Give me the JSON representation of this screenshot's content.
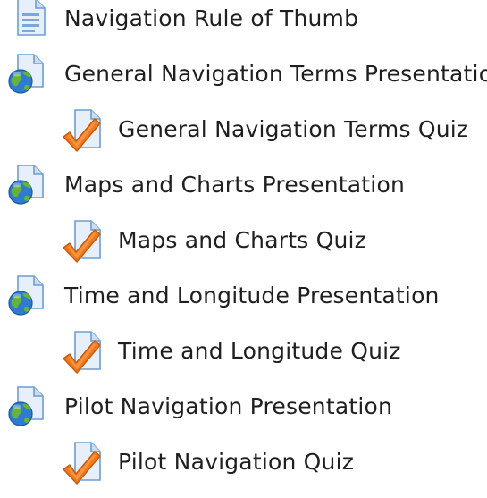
{
  "activities": [
    {
      "label": "Navigation Rule of Thumb",
      "icon": "page-icon",
      "type": "page",
      "level": 0
    },
    {
      "label": "General Navigation Terms Presentation",
      "icon": "url-globe-icon",
      "type": "url",
      "level": 0
    },
    {
      "label": "General Navigation Terms Quiz",
      "icon": "quiz-check-icon",
      "type": "quiz",
      "level": 1
    },
    {
      "label": "Maps and Charts Presentation",
      "icon": "url-globe-icon",
      "type": "url",
      "level": 0
    },
    {
      "label": "Maps and Charts Quiz",
      "icon": "quiz-check-icon",
      "type": "quiz",
      "level": 1
    },
    {
      "label": "Time and Longitude Presentation",
      "icon": "url-globe-icon",
      "type": "url",
      "level": 0
    },
    {
      "label": "Time and Longitude Quiz",
      "icon": "quiz-check-icon",
      "type": "quiz",
      "level": 1
    },
    {
      "label": "Pilot Navigation Presentation",
      "icon": "url-globe-icon",
      "type": "url",
      "level": 0
    },
    {
      "label": "Pilot Navigation Quiz",
      "icon": "quiz-check-icon",
      "type": "quiz",
      "level": 1
    }
  ],
  "colors": {
    "text": "#1f1f1f",
    "doc_fill": "#dbe9f7",
    "doc_stroke": "#5b8fc7",
    "globe_blue": "#2a74c9",
    "globe_green": "#5fae3a",
    "check_orange": "#f07a1e"
  }
}
